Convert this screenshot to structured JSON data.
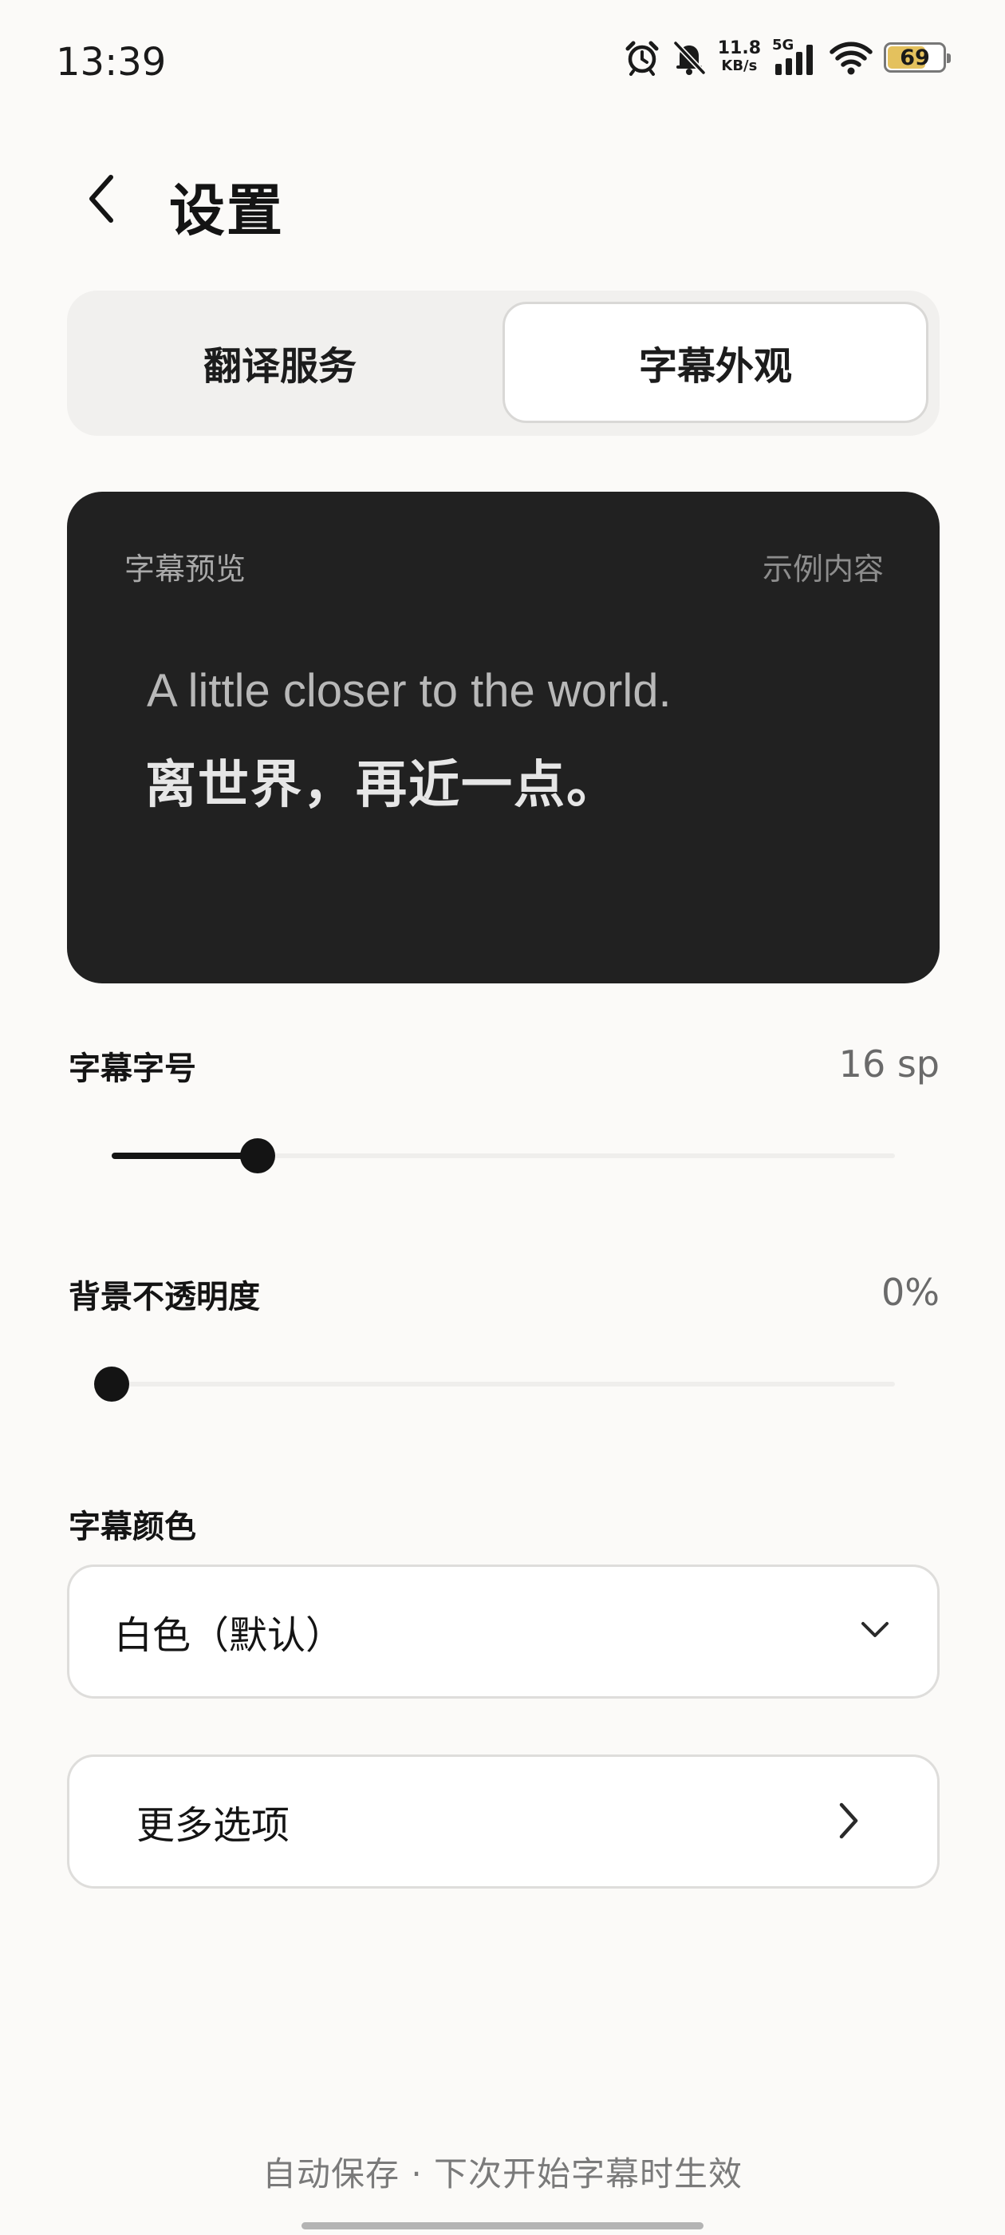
{
  "status_bar": {
    "time": "13:39",
    "net_speed": "11.8",
    "net_unit": "KB/s",
    "network": "5G",
    "battery_level": "69",
    "icons": [
      "alarm-icon",
      "bell-off-icon",
      "signal-icon",
      "wifi-icon",
      "battery-icon"
    ]
  },
  "header": {
    "back_icon": "chevron-left-icon",
    "title": "设置"
  },
  "tabs": [
    {
      "label": "翻译服务",
      "selected": false
    },
    {
      "label": "字幕外观",
      "selected": true
    }
  ],
  "preview": {
    "label": "字幕预览",
    "sample_label": "示例内容",
    "english": "A little closer to the world.",
    "chinese": "离世界，再近一点。"
  },
  "font_size": {
    "label": "字幕字号",
    "value": "16 sp",
    "slider_fraction": 0.186
  },
  "opacity": {
    "label": "背景不透明度",
    "value": "0%",
    "slider_fraction": 0
  },
  "color": {
    "label": "字幕颜色",
    "selected": "白色（默认）",
    "icon": "chevron-down-icon"
  },
  "more_options": {
    "label": "更多选项",
    "icon": "chevron-right-icon"
  },
  "footer_note": "自动保存 · 下次开始字幕时生效",
  "colors": {
    "background": "#fbfaf8",
    "preview_bg": "#212121",
    "accent": "#141414"
  }
}
